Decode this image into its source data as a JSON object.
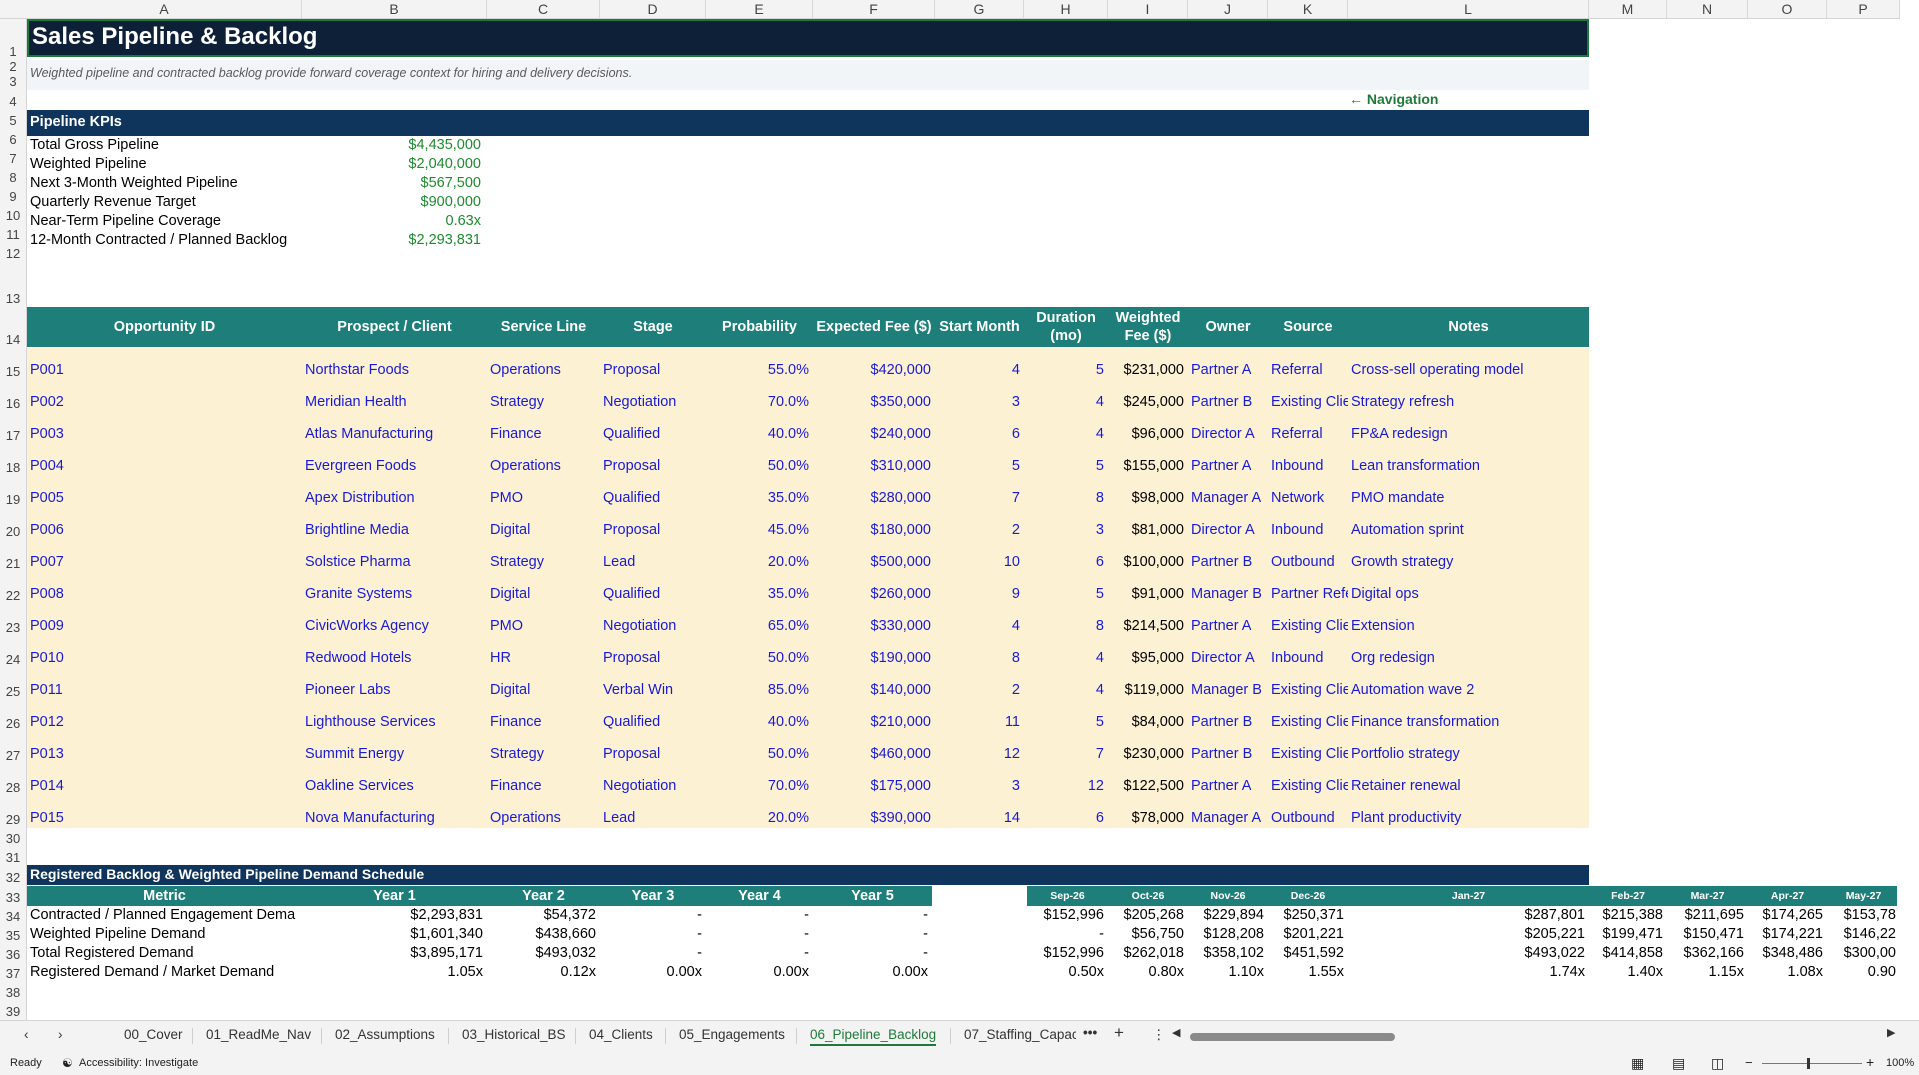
{
  "columns": [
    "A",
    "B",
    "C",
    "D",
    "E",
    "F",
    "G",
    "H",
    "I",
    "J",
    "K",
    "L",
    "M",
    "N",
    "O",
    "P"
  ],
  "rows": [
    "1",
    "2",
    "3",
    "4",
    "5",
    "6",
    "7",
    "8",
    "9",
    "10",
    "11",
    "12",
    "13",
    "14",
    "15",
    "16",
    "17",
    "18",
    "19",
    "20",
    "21",
    "22",
    "23",
    "24",
    "25",
    "26",
    "27",
    "28",
    "29",
    "30",
    "31",
    "32",
    "33",
    "34",
    "35",
    "36",
    "37",
    "38",
    "39"
  ],
  "title": "Sales Pipeline & Backlog",
  "subtitle": "Weighted pipeline and contracted backlog provide forward coverage context for hiring and delivery decisions.",
  "nav_link": "← Navigation",
  "kpi_section": "Pipeline KPIs",
  "kpis": [
    {
      "label": "Total Gross Pipeline",
      "value": "$4,435,000"
    },
    {
      "label": "Weighted Pipeline",
      "value": "$2,040,000"
    },
    {
      "label": "Next 3-Month Weighted Pipeline",
      "value": "$567,500"
    },
    {
      "label": "Quarterly Revenue Target",
      "value": "$900,000"
    },
    {
      "label": "Near-Term Pipeline Coverage",
      "value": "0.63x"
    },
    {
      "label": "12-Month Contracted / Planned Backlog",
      "value": "$2,293,831"
    }
  ],
  "table": {
    "headers": [
      "Opportunity ID",
      "Prospect / Client",
      "Service Line",
      "Stage",
      "Probability",
      "Expected Fee ($)",
      "Start Month",
      "Duration (mo)",
      "Weighted Fee ($)",
      "Owner",
      "Source",
      "Notes"
    ],
    "rows": [
      [
        "P001",
        "Northstar Foods",
        "Operations",
        "Proposal",
        "55.0%",
        "$420,000",
        "4",
        "5",
        "$231,000",
        "Partner A",
        "Referral",
        "Cross-sell operating model"
      ],
      [
        "P002",
        "Meridian Health",
        "Strategy",
        "Negotiation",
        "70.0%",
        "$350,000",
        "3",
        "4",
        "$245,000",
        "Partner B",
        "Existing Clie",
        "Strategy refresh"
      ],
      [
        "P003",
        "Atlas Manufacturing",
        "Finance",
        "Qualified",
        "40.0%",
        "$240,000",
        "6",
        "4",
        "$96,000",
        "Director A",
        "Referral",
        "FP&A redesign"
      ],
      [
        "P004",
        "Evergreen Foods",
        "Operations",
        "Proposal",
        "50.0%",
        "$310,000",
        "5",
        "5",
        "$155,000",
        "Partner A",
        "Inbound",
        "Lean transformation"
      ],
      [
        "P005",
        "Apex Distribution",
        "PMO",
        "Qualified",
        "35.0%",
        "$280,000",
        "7",
        "8",
        "$98,000",
        "Manager A",
        "Network",
        "PMO mandate"
      ],
      [
        "P006",
        "Brightline Media",
        "Digital",
        "Proposal",
        "45.0%",
        "$180,000",
        "2",
        "3",
        "$81,000",
        "Director A",
        "Inbound",
        "Automation sprint"
      ],
      [
        "P007",
        "Solstice Pharma",
        "Strategy",
        "Lead",
        "20.0%",
        "$500,000",
        "10",
        "6",
        "$100,000",
        "Partner B",
        "Outbound",
        "Growth strategy"
      ],
      [
        "P008",
        "Granite Systems",
        "Digital",
        "Qualified",
        "35.0%",
        "$260,000",
        "9",
        "5",
        "$91,000",
        "Manager B",
        "Partner Refe",
        "Digital ops"
      ],
      [
        "P009",
        "CivicWorks Agency",
        "PMO",
        "Negotiation",
        "65.0%",
        "$330,000",
        "4",
        "8",
        "$214,500",
        "Partner A",
        "Existing Clie",
        "Extension"
      ],
      [
        "P010",
        "Redwood Hotels",
        "HR",
        "Proposal",
        "50.0%",
        "$190,000",
        "8",
        "4",
        "$95,000",
        "Director A",
        "Inbound",
        "Org redesign"
      ],
      [
        "P011",
        "Pioneer Labs",
        "Digital",
        "Verbal Win",
        "85.0%",
        "$140,000",
        "2",
        "4",
        "$119,000",
        "Manager B",
        "Existing Clie",
        "Automation wave 2"
      ],
      [
        "P012",
        "Lighthouse Services",
        "Finance",
        "Qualified",
        "40.0%",
        "$210,000",
        "11",
        "5",
        "$84,000",
        "Partner B",
        "Existing Clie",
        "Finance transformation"
      ],
      [
        "P013",
        "Summit Energy",
        "Strategy",
        "Proposal",
        "50.0%",
        "$460,000",
        "12",
        "7",
        "$230,000",
        "Partner B",
        "Existing Clie",
        "Portfolio strategy"
      ],
      [
        "P014",
        "Oakline Services",
        "Finance",
        "Negotiation",
        "70.0%",
        "$175,000",
        "3",
        "12",
        "$122,500",
        "Partner A",
        "Existing Clie",
        "Retainer renewal"
      ],
      [
        "P015",
        "Nova Manufacturing",
        "Operations",
        "Lead",
        "20.0%",
        "$390,000",
        "14",
        "6",
        "$78,000",
        "Manager A",
        "Outbound",
        "Plant productivity"
      ]
    ]
  },
  "schedule": {
    "title": "Registered Backlog & Weighted Pipeline Demand Schedule",
    "headers": [
      "Metric",
      "Year 1",
      "Year 2",
      "Year 3",
      "Year 4",
      "Year 5"
    ],
    "month_headers": [
      "Sep-26",
      "Oct-26",
      "Nov-26",
      "Dec-26",
      "Jan-27",
      "Feb-27",
      "Mar-27",
      "Apr-27",
      "May-27"
    ],
    "rows": [
      {
        "label": "Contracted / Planned Engagement Dema",
        "years": [
          "$2,293,831",
          "$54,372",
          "-",
          "-",
          "-"
        ],
        "months": [
          "$152,996",
          "$205,268",
          "$229,894",
          "$250,371",
          "$287,801",
          "$215,388",
          "$211,695",
          "$174,265",
          "$153,78"
        ]
      },
      {
        "label": "Weighted Pipeline Demand",
        "years": [
          "$1,601,340",
          "$438,660",
          "-",
          "-",
          "-"
        ],
        "months": [
          "-",
          "$56,750",
          "$128,208",
          "$201,221",
          "$205,221",
          "$199,471",
          "$150,471",
          "$174,221",
          "$146,22"
        ]
      },
      {
        "label": "Total Registered Demand",
        "years": [
          "$3,895,171",
          "$493,032",
          "-",
          "-",
          "-"
        ],
        "months": [
          "$152,996",
          "$262,018",
          "$358,102",
          "$451,592",
          "$493,022",
          "$414,858",
          "$362,166",
          "$348,486",
          "$300,00"
        ]
      },
      {
        "label": "Registered Demand / Market Demand",
        "years": [
          "1.05x",
          "0.12x",
          "0.00x",
          "0.00x",
          "0.00x"
        ],
        "months": [
          "0.50x",
          "0.80x",
          "1.10x",
          "1.55x",
          "1.74x",
          "1.40x",
          "1.15x",
          "1.08x",
          "0.90"
        ]
      }
    ]
  },
  "tabs": [
    "00_Cover",
    "01_ReadMe_Nav",
    "02_Assumptions",
    "03_Historical_BS",
    "04_Clients",
    "05_Engagements",
    "06_Pipeline_Backlog",
    "07_Staffing_Capac"
  ],
  "active_tab": "06_Pipeline_Backlog",
  "status": {
    "ready": "Ready",
    "accessibility": "Accessibility: Investigate",
    "zoom": "100%"
  },
  "tab_more": "•••",
  "tab_add": "+"
}
